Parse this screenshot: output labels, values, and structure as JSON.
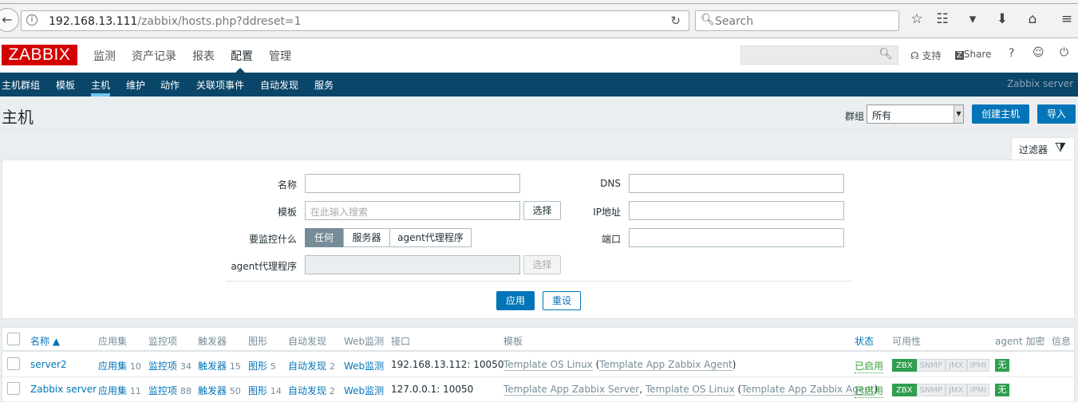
{
  "browser": {
    "url_host": "192.168.13.111",
    "url_path": "/zabbix/hosts.php?ddreset=1",
    "search_placeholder": "Search"
  },
  "header": {
    "logo": "ZABBIX",
    "menu": [
      "监测",
      "资产记录",
      "报表",
      "配置",
      "管理"
    ],
    "active_menu": "配置",
    "support": "支持",
    "share": "Share",
    "help": "?"
  },
  "nav": {
    "items": [
      "主机群组",
      "模板",
      "主机",
      "维护",
      "动作",
      "关联项事件",
      "自动发现",
      "服务"
    ],
    "active": "主机",
    "server": "Zabbix server"
  },
  "page": {
    "title": "主机",
    "group_label": "群组",
    "group_value": "所有",
    "create_button": "创建主机",
    "import_button": "导入"
  },
  "filter": {
    "tab": "过滤器",
    "name_label": "名称",
    "template_label": "模板",
    "template_placeholder": "在此输入搜索",
    "select": "选择",
    "monitored_by_label": "要监控什么",
    "monitored_by_options": [
      "任何",
      "服务器",
      "agent代理程序"
    ],
    "monitored_by_selected": "任何",
    "proxy_label": "agent代理程序",
    "dns_label": "DNS",
    "ip_label": "IP地址",
    "port_label": "端口",
    "apply": "应用",
    "reset": "重设"
  },
  "table": {
    "headers": {
      "name": "名称 ▲",
      "applications": "应用集",
      "items": "监控项",
      "triggers": "触发器",
      "graphs": "图形",
      "discovery": "自动发现",
      "web": "Web监测",
      "interface": "接口",
      "templates": "模板",
      "status": "状态",
      "availability": "可用性",
      "encryption": "agent 加密",
      "info": "信息"
    },
    "rows": [
      {
        "name": "server2",
        "applications": "应用集",
        "applications_count": "10",
        "items": "监控项",
        "items_count": "34",
        "triggers": "触发器",
        "triggers_count": "15",
        "graphs": "图形",
        "graphs_count": "5",
        "discovery": "自动发现",
        "discovery_count": "2",
        "web": "Web监测",
        "interface": "192.168.13.112: 10050",
        "templates": [
          "Template OS Linux"
        ],
        "parent_template": "Template App Zabbix Agent",
        "status": "已启用",
        "availability": [
          "ZBX",
          "SNMP",
          "JMX",
          "IPMI"
        ],
        "encryption": "无"
      },
      {
        "name": "Zabbix server",
        "applications": "应用集",
        "applications_count": "11",
        "items": "监控项",
        "items_count": "88",
        "triggers": "触发器",
        "triggers_count": "50",
        "graphs": "图形",
        "graphs_count": "14",
        "discovery": "自动发现",
        "discovery_count": "2",
        "web": "Web监测",
        "interface": "127.0.0.1: 10050",
        "templates": [
          "Template App Zabbix Server",
          "Template OS Linux"
        ],
        "parent_template": "Template App Zabbix Agent",
        "status": "已启用",
        "availability": [
          "ZBX",
          "SNMP",
          "JMX",
          "IPMI"
        ],
        "encryption": "无"
      }
    ]
  },
  "colors": {
    "brand": "#d40000",
    "nav": "#0a466a",
    "primary": "#0275b8",
    "success": "#2f9f4f"
  }
}
